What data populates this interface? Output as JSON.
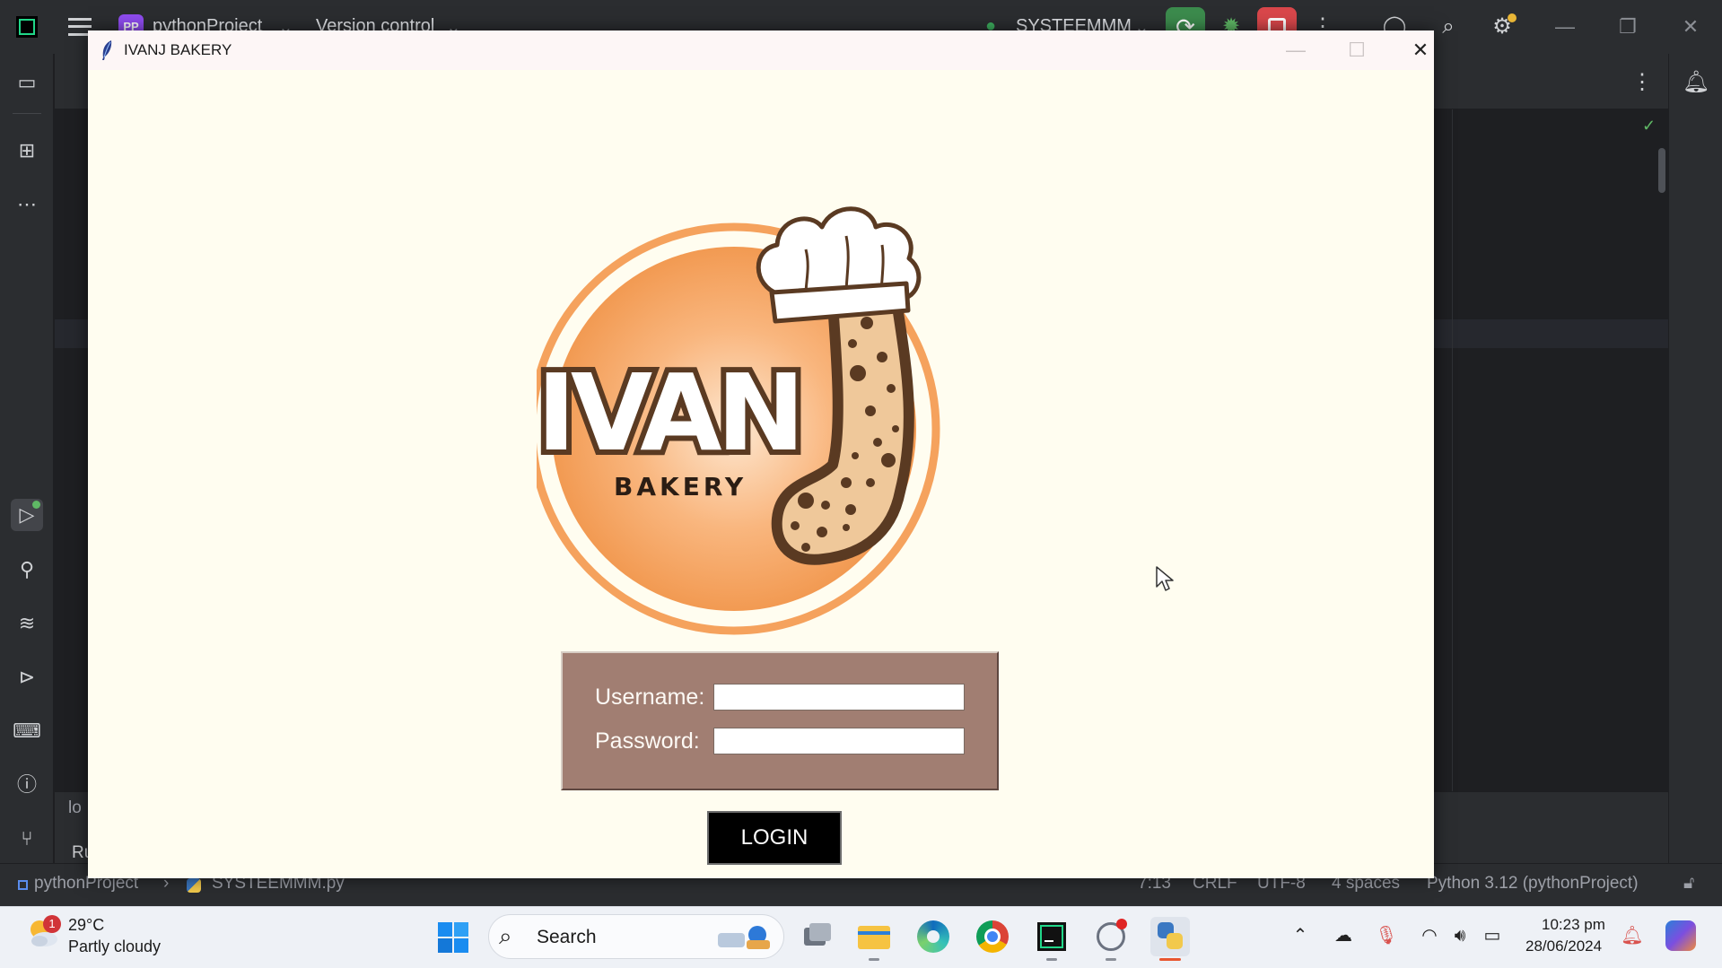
{
  "ide": {
    "project_name": "pythonProject",
    "vcs_label": "Version control",
    "run_config": "SYSTEEMMM",
    "project_badge": "PP",
    "bottom_label_1": "lo",
    "bottom_label_2": "Ru",
    "status_bar": {
      "breadcrumb_project": "pythonProject",
      "breadcrumb_file": "SYSTEEMMM.py",
      "position": "7:13",
      "line_endings": "CRLF",
      "encoding": "UTF-8",
      "indent": "4 spaces",
      "interpreter": "Python 3.12 (pythonProject)"
    },
    "icons": {
      "sidebar": [
        "folder-icon",
        "structure-icon",
        "more-icon",
        "run-icon",
        "python-console-icon",
        "layers-icon",
        "services-icon",
        "terminal-icon",
        "problems-icon",
        "git-icon"
      ],
      "right": [
        "notifications-icon"
      ]
    }
  },
  "app": {
    "window_title": "IVANJ BAKERY",
    "logo": {
      "big_text": "IVANJ",
      "sub_text": "BAKERY"
    },
    "login": {
      "username_label": "Username:",
      "password_label": "Password:",
      "username_value": "",
      "password_value": "",
      "button_label": "LOGIN"
    },
    "colors": {
      "background": "#fffdf0",
      "panel": "#a17e72",
      "button": "#000000",
      "logo_orange": "#f5a25d"
    }
  },
  "taskbar": {
    "weather_temp": "29°C",
    "weather_desc": "Partly cloudy",
    "weather_badge": "1",
    "search_label": "Search",
    "time": "10:23 pm",
    "date": "28/06/2024",
    "pinned_apps": [
      "windows-start-icon",
      "task-view-icon",
      "file-explorer-icon",
      "edge-icon",
      "chrome-icon",
      "pycharm-icon",
      "recorder-icon",
      "python-icon"
    ]
  }
}
